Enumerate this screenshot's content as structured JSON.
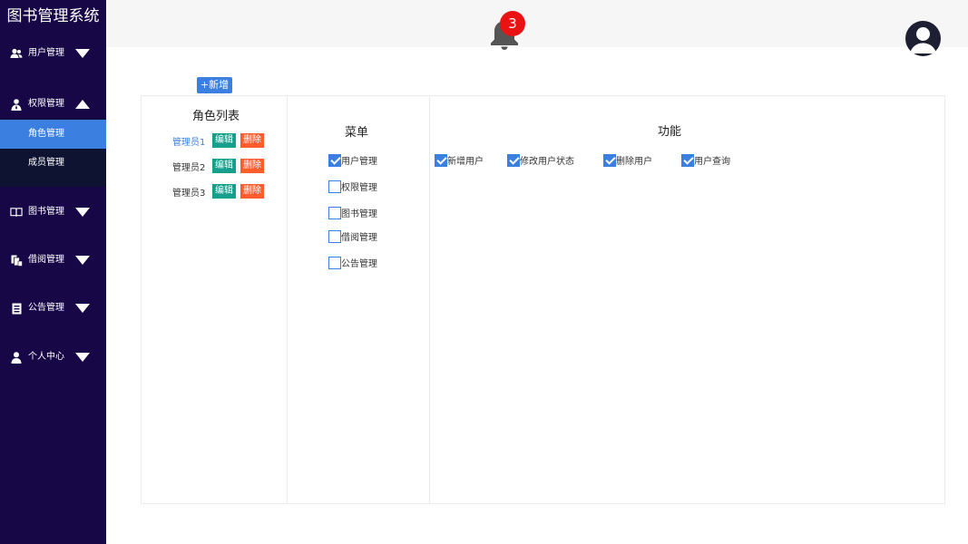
{
  "app": {
    "title": "图书管理系统"
  },
  "sidebar": {
    "items": [
      {
        "label": "用户管理",
        "icon": "users-icon",
        "expanded": false
      },
      {
        "label": "权限管理",
        "icon": "permission-user-icon",
        "expanded": true,
        "children": [
          {
            "label": "角色管理",
            "active": true
          },
          {
            "label": "成员管理",
            "active": false
          }
        ]
      },
      {
        "label": "图书管理",
        "icon": "book-icon",
        "expanded": false
      },
      {
        "label": "借阅管理",
        "icon": "borrow-icon",
        "expanded": false
      },
      {
        "label": "公告管理",
        "icon": "notice-icon",
        "expanded": false
      },
      {
        "label": "个人中心",
        "icon": "person-icon",
        "expanded": false
      }
    ]
  },
  "header": {
    "notification_count": "3"
  },
  "toolbar": {
    "add_label": "+新增"
  },
  "roles": {
    "title": "角色列表",
    "edit_label": "编辑",
    "delete_label": "删除",
    "items": [
      {
        "name": "管理员1",
        "active": true
      },
      {
        "name": "管理员2",
        "active": false
      },
      {
        "name": "管理员3",
        "active": false
      }
    ]
  },
  "menus": {
    "title": "菜单",
    "items": [
      {
        "label": "用户管理",
        "checked": true
      },
      {
        "label": "权限管理",
        "checked": false
      },
      {
        "label": "图书管理",
        "checked": false
      },
      {
        "label": "借阅管理",
        "checked": false
      },
      {
        "label": "公告管理",
        "checked": false
      }
    ]
  },
  "functions": {
    "title": "功能",
    "items": [
      {
        "label": "新增用户",
        "checked": true
      },
      {
        "label": "修改用户状态",
        "checked": true
      },
      {
        "label": "删除用户",
        "checked": true
      },
      {
        "label": "用户查询",
        "checked": true
      }
    ]
  },
  "colors": {
    "sidebar_bg": "#170747",
    "accent": "#3b7fe0",
    "edit": "#159f8c",
    "delete": "#fe5d2e",
    "badge": "#ea1313"
  }
}
